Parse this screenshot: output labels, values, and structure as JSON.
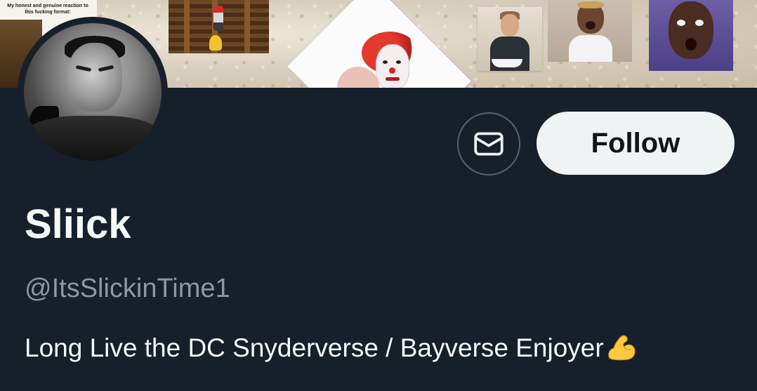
{
  "banner": {
    "meme_caption": "My honest and genuine reaction to this fucking format:"
  },
  "profile": {
    "display_name": "Sliick",
    "handle": "@ItsSlickinTime1",
    "bio": "Long Live the DC Snyderverse / Bayverse Enjoyer",
    "bio_emoji": "flexed-biceps-emoji"
  },
  "actions": {
    "message_icon": "envelope-icon",
    "follow_label": "Follow"
  },
  "colors": {
    "background": "#15202b",
    "primary_text": "#f7f9f9",
    "secondary_text": "#8b98a5",
    "follow_button_bg": "#eff3f4",
    "follow_button_text": "#0f1419",
    "outline": "#536471"
  }
}
